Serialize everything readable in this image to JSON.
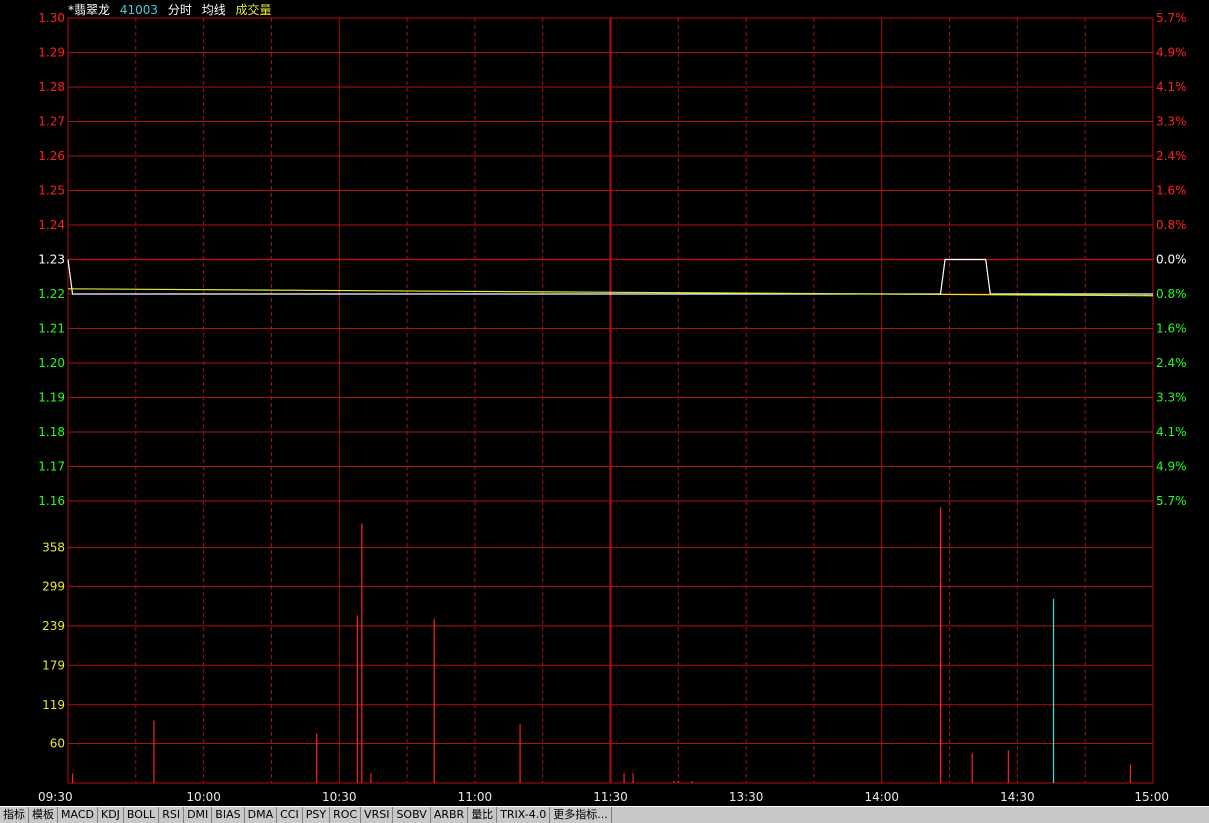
{
  "header": {
    "stock_name": "*翡翠龙",
    "stock_code": "41003",
    "mode_label": "分时",
    "avg_label": "均线",
    "vol_label": "成交量"
  },
  "colors": {
    "background": "#000000",
    "grid": "#b01010",
    "up": "#ff2020",
    "down": "#20ff20",
    "neutral": "#ffffff",
    "price_line": "#ffffff",
    "avg_line": "#e8e830",
    "volume_up": "#ff2020",
    "volume_down": "#40e0e0"
  },
  "toolbar": {
    "items": [
      "指标",
      "模板",
      "MACD",
      "KDJ",
      "BOLL",
      "RSI",
      "DMI",
      "BIAS",
      "DMA",
      "CCI",
      "PSY",
      "ROC",
      "VRSI",
      "SOBV",
      "ARBR",
      "量比",
      "TRIX-4.0",
      "更多指标..."
    ]
  },
  "chart_data": {
    "type": "line",
    "title": "",
    "prev_close": 1.23,
    "y_left_ticks": [
      "1.30",
      "1.29",
      "1.28",
      "1.27",
      "1.26",
      "1.25",
      "1.24",
      "1.23",
      "1.22",
      "1.21",
      "1.20",
      "1.19",
      "1.18",
      "1.17",
      "1.16"
    ],
    "y_right_ticks": [
      "5.7%",
      "4.9%",
      "4.1%",
      "3.3%",
      "2.4%",
      "1.6%",
      "0.8%",
      "0.0%",
      "0.8%",
      "1.6%",
      "2.4%",
      "3.3%",
      "4.1%",
      "4.9%",
      "5.7%"
    ],
    "ylim": [
      1.16,
      1.3
    ],
    "x_labels": [
      "09:30",
      "10:00",
      "10:30",
      "11:00",
      "11:30",
      "13:30",
      "14:00",
      "14:30",
      "15:00"
    ],
    "price_series": {
      "name": "分时",
      "points": [
        {
          "t": 0,
          "v": 1.23
        },
        {
          "t": 1,
          "v": 1.22
        },
        {
          "t": 193,
          "v": 1.22
        },
        {
          "t": 194,
          "v": 1.23
        },
        {
          "t": 203,
          "v": 1.23
        },
        {
          "t": 204,
          "v": 1.22
        },
        {
          "t": 240,
          "v": 1.22
        }
      ]
    },
    "avg_series": {
      "name": "均线",
      "points": [
        {
          "t": 0,
          "v": 1.2215
        },
        {
          "t": 240,
          "v": 1.2195
        }
      ]
    },
    "volume": {
      "name": "成交量",
      "y_ticks": [
        "358",
        "299",
        "239",
        "179",
        "119",
        "60"
      ],
      "ylim": [
        0,
        400
      ],
      "bars": [
        {
          "t": 1,
          "v": 15,
          "dir": "up"
        },
        {
          "t": 19,
          "v": 95,
          "dir": "up"
        },
        {
          "t": 55,
          "v": 75,
          "dir": "up"
        },
        {
          "t": 64,
          "v": 255,
          "dir": "up"
        },
        {
          "t": 65,
          "v": 395,
          "dir": "up"
        },
        {
          "t": 67,
          "v": 15,
          "dir": "up"
        },
        {
          "t": 81,
          "v": 250,
          "dir": "up"
        },
        {
          "t": 100,
          "v": 90,
          "dir": "up"
        },
        {
          "t": 123,
          "v": 15,
          "dir": "up"
        },
        {
          "t": 125,
          "v": 15,
          "dir": "up"
        },
        {
          "t": 134,
          "v": 3,
          "dir": "up"
        },
        {
          "t": 135,
          "v": 3,
          "dir": "up"
        },
        {
          "t": 138,
          "v": 3,
          "dir": "up"
        },
        {
          "t": 193,
          "v": 420,
          "dir": "up"
        },
        {
          "t": 200,
          "v": 45,
          "dir": "up"
        },
        {
          "t": 208,
          "v": 50,
          "dir": "up"
        },
        {
          "t": 218,
          "v": 280,
          "dir": "down"
        },
        {
          "t": 235,
          "v": 28,
          "dir": "up"
        }
      ]
    },
    "grid": true
  }
}
